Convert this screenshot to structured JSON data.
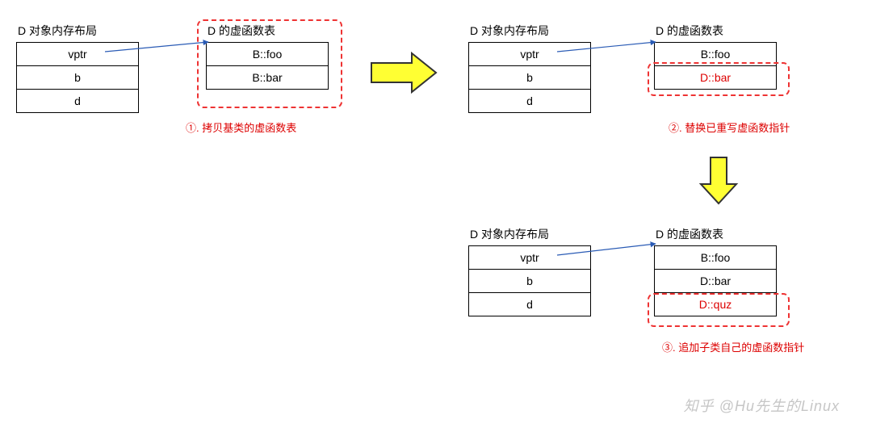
{
  "titles": {
    "mem": "D 对象内存布局",
    "vtbl": "D 的虚函数表"
  },
  "mem_rows": [
    "vptr",
    "b",
    "d"
  ],
  "stage1": {
    "vtbl": [
      "B::foo",
      "B::bar"
    ],
    "caption": "①. 拷贝基类的虚函数表"
  },
  "stage2": {
    "vtbl": [
      "B::foo",
      "D::bar"
    ],
    "caption": "②. 替换已重写虚函数指针"
  },
  "stage3": {
    "vtbl": [
      "B::foo",
      "D::bar",
      "D::quz"
    ],
    "caption": "③. 追加子类自己的虚函数指针"
  },
  "watermark": "知乎 @Hu先生的Linux"
}
